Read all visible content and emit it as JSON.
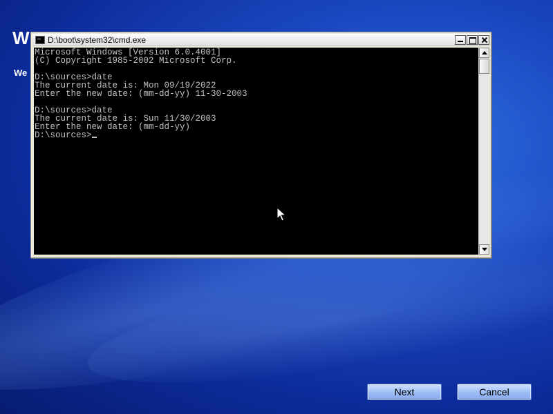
{
  "background": {
    "heading": "W",
    "subtext": "We"
  },
  "window": {
    "title": "D:\\boot\\system32\\cmd.exe",
    "icon": "console-icon",
    "controls": [
      "minimize-icon",
      "maximize-icon",
      "close-icon"
    ]
  },
  "console": {
    "lines": [
      "Microsoft Windows [Version 6.0.4001]",
      "(C) Copyright 1985-2002 Microsoft Corp.",
      "",
      "D:\\sources>date",
      "The current date is: Mon 09/19/2022",
      "Enter the new date: (mm-dd-yy) 11-30-2003",
      "",
      "D:\\sources>date",
      "The current date is: Sun 11/30/2003",
      "Enter the new date: (mm-dd-yy)",
      "D:\\sources>"
    ]
  },
  "buttons": {
    "next": "Next",
    "cancel": "Cancel"
  },
  "colors": {
    "console_bg": "#000000",
    "console_fg": "#c0c0c0",
    "desktop": "#1a48c0"
  }
}
